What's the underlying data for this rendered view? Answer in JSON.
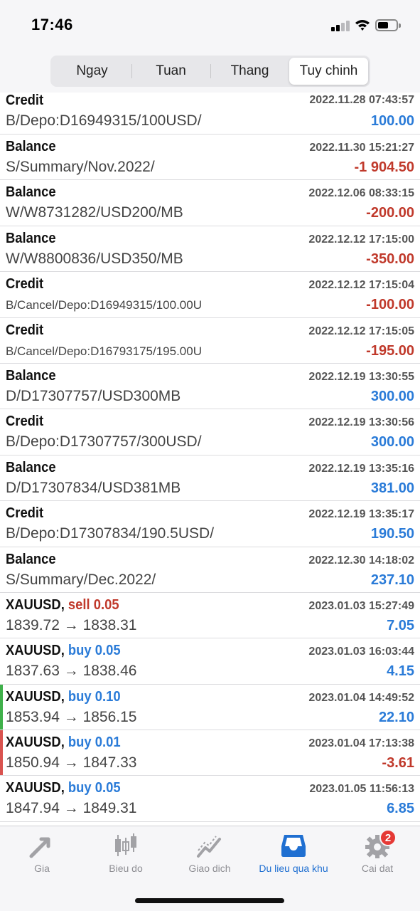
{
  "status_bar": {
    "time": "17:46"
  },
  "segments": [
    {
      "label": "Ngay"
    },
    {
      "label": "Tuan"
    },
    {
      "label": "Thang"
    },
    {
      "label": "Tuy chinh"
    }
  ],
  "history": [
    {
      "title": "Credit",
      "description": "B/Depo:D16949315/100USD/",
      "datetime": "2022.11.28 07:43:57",
      "amount": "100.00",
      "sign": "pos"
    },
    {
      "title": "Balance",
      "description": "S/Summary/Nov.2022/",
      "datetime": "2022.11.30 15:21:27",
      "amount": "-1 904.50",
      "sign": "neg"
    },
    {
      "title": "Balance",
      "description": "W/W8731282/USD200/MB",
      "datetime": "2022.12.06 08:33:15",
      "amount": "-200.00",
      "sign": "neg"
    },
    {
      "title": "Balance",
      "description": "W/W8800836/USD350/MB",
      "datetime": "2022.12.12 17:15:00",
      "amount": "-350.00",
      "sign": "neg"
    },
    {
      "title": "Credit",
      "description": "B/Cancel/Depo:D16949315/100.00U",
      "datetime": "2022.12.12 17:15:04",
      "amount": "-100.00",
      "sign": "neg",
      "small": true
    },
    {
      "title": "Credit",
      "description": "B/Cancel/Depo:D16793175/195.00U",
      "datetime": "2022.12.12 17:15:05",
      "amount": "-195.00",
      "sign": "neg",
      "small": true
    },
    {
      "title": "Balance",
      "description": "D/D17307757/USD300MB",
      "datetime": "2022.12.19 13:30:55",
      "amount": "300.00",
      "sign": "pos"
    },
    {
      "title": "Credit",
      "description": "B/Depo:D17307757/300USD/",
      "datetime": "2022.12.19 13:30:56",
      "amount": "300.00",
      "sign": "pos"
    },
    {
      "title": "Balance",
      "description": "D/D17307834/USD381MB",
      "datetime": "2022.12.19 13:35:16",
      "amount": "381.00",
      "sign": "pos"
    },
    {
      "title": "Credit",
      "description": "B/Depo:D17307834/190.5USD/",
      "datetime": "2022.12.19 13:35:17",
      "amount": "190.50",
      "sign": "pos"
    },
    {
      "title": "Balance",
      "description": "S/Summary/Dec.2022/",
      "datetime": "2022.12.30 14:18:02",
      "amount": "237.10",
      "sign": "pos"
    },
    {
      "title": "XAUUSD,",
      "action": "sell 0.05",
      "action_type": "sell",
      "description": "1839.72 → 1838.31",
      "datetime": "2023.01.03 15:27:49",
      "amount": "7.05",
      "sign": "pos"
    },
    {
      "title": "XAUUSD,",
      "action": "buy 0.05",
      "action_type": "buy",
      "description": "1837.63 → 1838.46",
      "datetime": "2023.01.03 16:03:44",
      "amount": "4.15",
      "sign": "pos"
    },
    {
      "title": "XAUUSD,",
      "action": "buy 0.10",
      "action_type": "buy",
      "description": "1853.94 → 1856.15",
      "datetime": "2023.01.04 14:49:52",
      "amount": "22.10",
      "sign": "pos",
      "marker": "green"
    },
    {
      "title": "XAUUSD,",
      "action": "buy 0.01",
      "action_type": "buy",
      "description": "1850.94 → 1847.33",
      "datetime": "2023.01.04 17:13:38",
      "amount": "-3.61",
      "sign": "neg",
      "marker": "red"
    },
    {
      "title": "XAUUSD,",
      "action": "buy 0.05",
      "action_type": "buy",
      "description": "1847.94 → 1849.31",
      "datetime": "2023.01.05 11:56:13",
      "amount": "6.85",
      "sign": "pos"
    }
  ],
  "tabbar": {
    "items": [
      {
        "label": "Gia",
        "icon": "quotes-arrows-icon"
      },
      {
        "label": "Bieu do",
        "icon": "candlestick-chart-icon"
      },
      {
        "label": "Giao dich",
        "icon": "trade-chart-icon"
      },
      {
        "label": "Du lieu qua khu",
        "icon": "history-inbox-icon"
      },
      {
        "label": "Cai dat",
        "icon": "settings-gear-icon"
      }
    ],
    "settings_badge": "2"
  },
  "colors": {
    "positive": "#2a7bd8",
    "negative": "#c0392b",
    "active_tab": "#1f6fd1"
  }
}
